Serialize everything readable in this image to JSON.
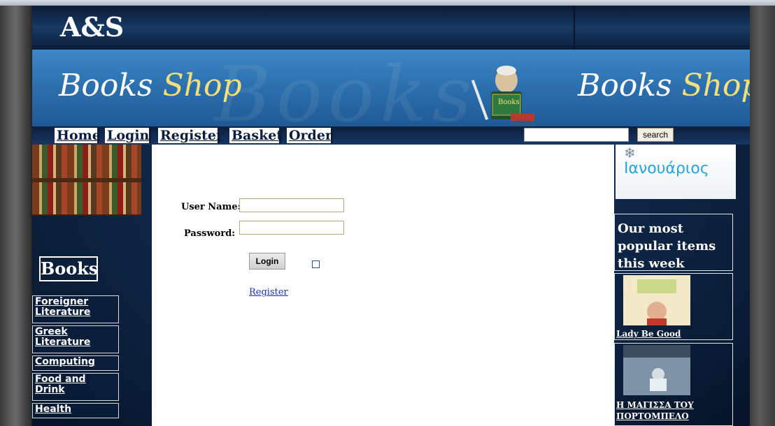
{
  "header": {
    "site_logo": "A&S",
    "brand_left_1": "Books",
    "brand_left_2": "Shop",
    "brand_right_1": "Books",
    "brand_right_2": "Shop",
    "ghost_text": "Books"
  },
  "nav": {
    "items": [
      {
        "label": "Home"
      },
      {
        "label": "Login"
      },
      {
        "label": "Register"
      },
      {
        "label": "Basket"
      },
      {
        "label": "Order"
      }
    ],
    "search_value": "",
    "search_button": "search"
  },
  "sidebar": {
    "title": "Books",
    "categories": [
      {
        "label": "Foreigner Literature"
      },
      {
        "label": "Greek Literature"
      },
      {
        "label": "Computing"
      },
      {
        "label": "Food and Drink"
      },
      {
        "label": "Health"
      }
    ]
  },
  "login_form": {
    "username_label": "User Name:",
    "username_value": "",
    "password_label": "Password:",
    "password_value": "",
    "login_button": "Login",
    "remember_checked": false,
    "register_link": "Register"
  },
  "right": {
    "month_banner": "Ιανουάριος",
    "popular_heading": "Our most popular items this week",
    "items": [
      {
        "title": "Lady Be Good"
      },
      {
        "title": "Η ΜΑΓΙΣΣΑ ΤΟΥ ΠΟΡΤΟΜΠΕΛΟ"
      }
    ]
  },
  "colors": {
    "page_bg": "#0f2748",
    "banner": "#2c6fae",
    "brand_accent": "#f4e07a",
    "link": "#1a2fbd"
  }
}
